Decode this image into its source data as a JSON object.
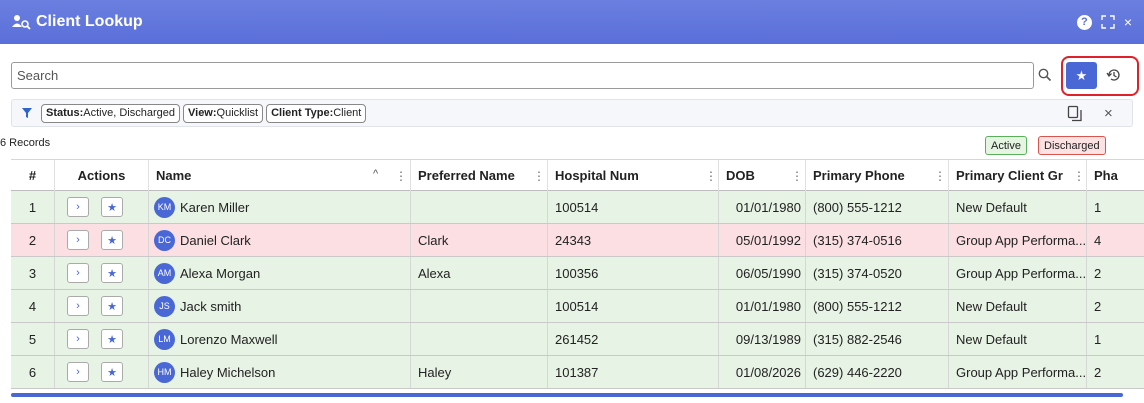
{
  "window": {
    "title": "Client Lookup",
    "help_label": "?",
    "expand_icon": "expand-icon",
    "close_label": "×"
  },
  "search": {
    "placeholder": "Search",
    "value": ""
  },
  "filters": {
    "chips": [
      {
        "key": "Status:",
        "value": "Active, Discharged"
      },
      {
        "key": "View:",
        "value": "Quicklist"
      },
      {
        "key": "Client Type:",
        "value": "Client"
      }
    ],
    "close_label": "×"
  },
  "records_label": "6 Records",
  "legend": {
    "active": "Active",
    "discharged": "Discharged",
    "active_color": "#e7f3e4",
    "discharged_color": "#fbdfe2"
  },
  "columns": [
    "#",
    "Actions",
    "Name",
    "Preferred Name",
    "Hospital Num",
    "DOB",
    "Primary Phone",
    "Primary Client Gr",
    "Pha"
  ],
  "rows": [
    {
      "num": "1",
      "status": "active",
      "initials": "KM",
      "name": "Karen Miller",
      "preferred": "",
      "hospital": "100514",
      "dob": "01/01/1980",
      "phone": "(800) 555-1212",
      "group": "New Default",
      "pha": "1"
    },
    {
      "num": "2",
      "status": "discharged",
      "initials": "DC",
      "name": "Daniel Clark",
      "preferred": "Clark",
      "hospital": "24343",
      "dob": "05/01/1992",
      "phone": "(315) 374-0516",
      "group": "Group App Performa...",
      "pha": "4"
    },
    {
      "num": "3",
      "status": "active",
      "initials": "AM",
      "name": "Alexa Morgan",
      "preferred": "Alexa",
      "hospital": "100356",
      "dob": "06/05/1990",
      "phone": "(315) 374-0520",
      "group": "Group App Performa...",
      "pha": "2"
    },
    {
      "num": "4",
      "status": "active",
      "initials": "JS",
      "name": "Jack smith",
      "preferred": "",
      "hospital": "100514",
      "dob": "01/01/1980",
      "phone": "(800) 555-1212",
      "group": "New Default",
      "pha": "2"
    },
    {
      "num": "5",
      "status": "active",
      "initials": "LM",
      "name": "Lorenzo Maxwell",
      "preferred": "",
      "hospital": "261452",
      "dob": "09/13/1989",
      "phone": "(315) 882-2546",
      "group": "New Default",
      "pha": "1"
    },
    {
      "num": "6",
      "status": "active",
      "initials": "HM",
      "name": "Haley Michelson",
      "preferred": "Haley",
      "hospital": "101387",
      "dob": "01/08/2026",
      "phone": "(629) 446-2220",
      "group": "Group App Performa...",
      "pha": "2"
    }
  ]
}
